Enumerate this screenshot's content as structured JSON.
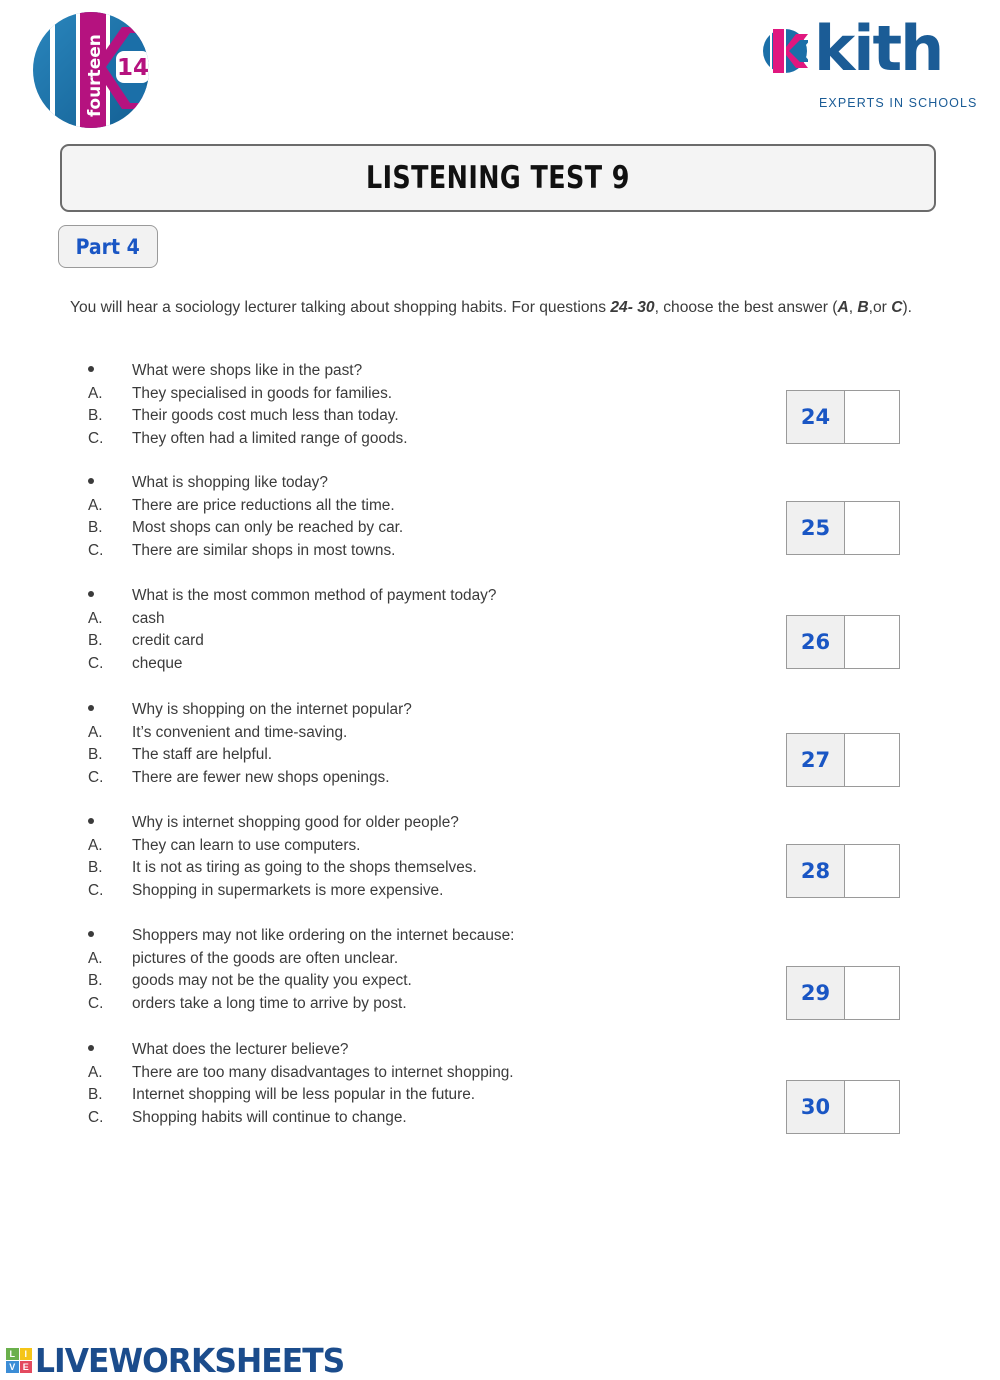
{
  "header": {
    "unit_logo": {
      "word": "fourteen",
      "number": "14",
      "icon": "fourteen-circle-logo",
      "colors": {
        "blue": "#1b6fa8",
        "magenta": "#b5127f"
      }
    },
    "brand_logo": {
      "wordmark": "kith",
      "tagline": "EXPERTS IN SCHOOLS",
      "icon": "kith-circle-icon",
      "color": "#1b5c96"
    }
  },
  "title": {
    "text": "LISTENING TEST 9"
  },
  "part_badge": {
    "label": "Part 4",
    "color": "#1a56c4"
  },
  "instructions": {
    "before_range": "You will hear a sociology lecturer talking about shopping habits. For questions ",
    "range": "24- 30",
    "middle": ", choose the best answer (",
    "option_a": "A",
    "comma": ", ",
    "option_b": "B",
    "or": ",or ",
    "option_c": "C",
    "end": ")."
  },
  "questions": [
    {
      "number": "24",
      "prompt": "What were shops like in the past?",
      "options": [
        {
          "letter": "A.",
          "text": "They specialised in goods for families."
        },
        {
          "letter": "B.",
          "text": "Their goods cost much less than today."
        },
        {
          "letter": "C.",
          "text": "They often had a limited range of goods."
        }
      ],
      "answer": ""
    },
    {
      "number": "25",
      "prompt": "What is shopping like today?",
      "options": [
        {
          "letter": "A.",
          "text": "There are price reductions all the time."
        },
        {
          "letter": "B.",
          "text": "Most shops can only be reached by car."
        },
        {
          "letter": "C.",
          "text": "There are similar shops in most towns."
        }
      ],
      "answer": ""
    },
    {
      "number": "26",
      "prompt": "What is the most common method of payment today?",
      "options": [
        {
          "letter": "A.",
          "text": "cash"
        },
        {
          "letter": "B.",
          "text": "credit card"
        },
        {
          "letter": "C.",
          "text": "cheque"
        }
      ],
      "answer": ""
    },
    {
      "number": "27",
      "prompt": "Why is shopping on the internet popular?",
      "options": [
        {
          "letter": "A.",
          "text": "It’s convenient and time-saving."
        },
        {
          "letter": "B.",
          "text": "The staff are helpful."
        },
        {
          "letter": "C.",
          "text": "There are fewer new shops openings."
        }
      ],
      "answer": ""
    },
    {
      "number": "28",
      "prompt": "Why is internet shopping good for older people?",
      "options": [
        {
          "letter": "A.",
          "text": "They can learn to use computers."
        },
        {
          "letter": "B.",
          "text": "It is not as tiring as going to the shops themselves."
        },
        {
          "letter": "C.",
          "text": "Shopping in supermarkets is more expensive."
        }
      ],
      "answer": ""
    },
    {
      "number": "29",
      "prompt": "Shoppers may not like ordering on the internet because:",
      "options": [
        {
          "letter": "A.",
          "text": "pictures of the goods are often unclear."
        },
        {
          "letter": "B.",
          "text": "goods may not be the quality you expect."
        },
        {
          "letter": "C.",
          "text": "orders take a long time to arrive by post."
        }
      ],
      "answer": ""
    },
    {
      "number": "30",
      "prompt": "What does the lecturer believe?",
      "options": [
        {
          "letter": "A.",
          "text": "There are too many disadvantages to internet shopping."
        },
        {
          "letter": "B.",
          "text": "Internet shopping will be less popular in the future."
        },
        {
          "letter": "C.",
          "text": "Shopping habits will continue to change."
        }
      ],
      "answer": ""
    }
  ],
  "footer": {
    "brand": "LIVEWORKSHEETS",
    "grid_letters": [
      "L",
      "I",
      "V",
      "E"
    ],
    "grid_colors": [
      "#6ab04c",
      "#f5c518",
      "#3c8dd6",
      "#e34a5f"
    ],
    "brand_color": "#1b4c8c"
  }
}
